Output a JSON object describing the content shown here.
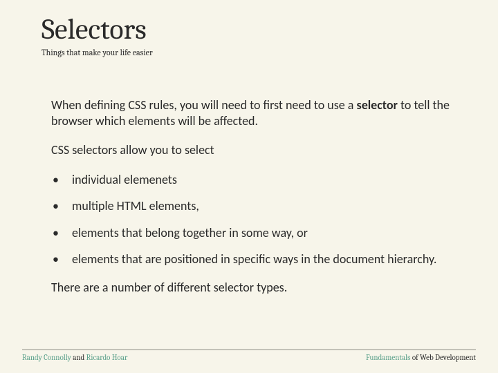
{
  "header": {
    "title": "Selectors",
    "subtitle": "Things that make your life easier"
  },
  "body": {
    "intro_pre": "When defining CSS rules, you will need to first need to use a ",
    "intro_bold": "selector",
    "intro_post": " to tell the browser which elements will be affected.",
    "lead": "CSS selectors allow you to select",
    "bullets": [
      "individual  elemenets",
      "multiple HTML elements,",
      "elements that belong together in some way, or",
      "elements that are positioned in specific ways in the document hierarchy."
    ],
    "outro": "There are a number of different selector types."
  },
  "footer": {
    "left_author1": "Randy Connolly",
    "left_join": " and ",
    "left_author2": "Ricardo Hoar",
    "right_pre": "Fundamentals",
    "right_post": " of Web Development"
  }
}
